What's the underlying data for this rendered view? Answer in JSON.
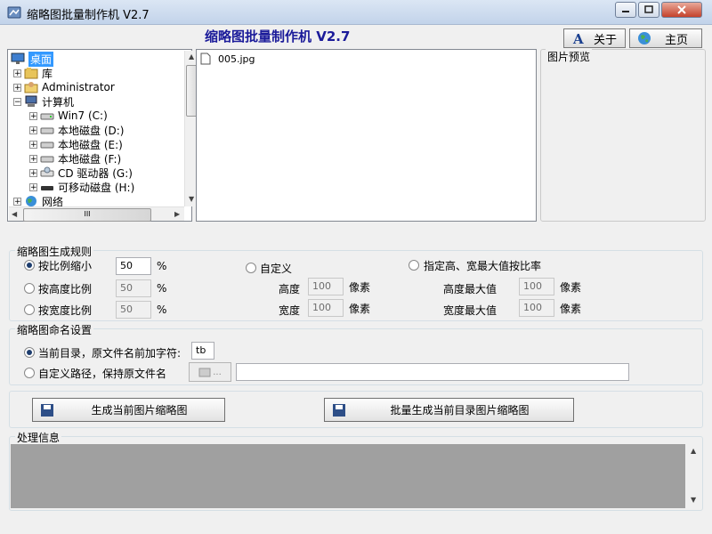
{
  "window": {
    "title": "缩略图批量制作机 V2.7"
  },
  "header": {
    "title": "缩略图批量制作机  V2.7",
    "about_label": "关于",
    "home_label": "主页"
  },
  "tree": {
    "items": [
      {
        "label": "桌面",
        "icon": "desktop-icon"
      },
      {
        "label": "库",
        "icon": "library-icon"
      },
      {
        "label": "Administrator",
        "icon": "user-folder-icon"
      },
      {
        "label": "计算机",
        "icon": "computer-icon"
      },
      {
        "label": "Win7 (C:)",
        "icon": "drive-icon"
      },
      {
        "label": "本地磁盘 (D:)",
        "icon": "drive-icon"
      },
      {
        "label": "本地磁盘 (E:)",
        "icon": "drive-icon"
      },
      {
        "label": "本地磁盘 (F:)",
        "icon": "drive-icon"
      },
      {
        "label": "CD 驱动器 (G:)",
        "icon": "cd-drive-icon"
      },
      {
        "label": "可移动磁盘 (H:)",
        "icon": "removable-drive-icon"
      },
      {
        "label": "网络",
        "icon": "network-icon"
      }
    ],
    "hscroll_label": "III"
  },
  "files": [
    {
      "name": "005.jpg",
      "icon": "file-icon"
    }
  ],
  "preview": {
    "label": "图片预览"
  },
  "rules": {
    "label": "缩略图生成规则",
    "by_ratio": {
      "label": "按比例缩小",
      "value": "50",
      "unit": "%"
    },
    "by_height": {
      "label": "按高度比例",
      "value": "50",
      "unit": "%"
    },
    "by_width": {
      "label": "按宽度比例",
      "value": "50",
      "unit": "%"
    },
    "custom": {
      "label": "自定义",
      "height_label": "高度",
      "height_value": "100",
      "width_label": "宽度",
      "width_value": "100",
      "unit": "像素"
    },
    "maxwh": {
      "label": "指定高、宽最大值按比率",
      "height_label": "高度最大值",
      "height_value": "100",
      "width_label": "宽度最大值",
      "width_value": "100",
      "unit": "像素"
    }
  },
  "naming": {
    "label": "缩略图命名设置",
    "current_dir": {
      "label": "当前目录，原文件名前加字符:",
      "value": "tb"
    },
    "custom_path": {
      "label": "自定义路径，保持原文件名",
      "browse_label": "...",
      "value": ""
    }
  },
  "actions": {
    "gen_current": "生成当前图片缩略图",
    "gen_batch": "批量生成当前目录图片缩略图"
  },
  "log": {
    "label": "处理信息"
  },
  "colors": {
    "accent": "#1b1b9a",
    "selection": "#3399ff",
    "log_bg": "#a0a0a0"
  }
}
